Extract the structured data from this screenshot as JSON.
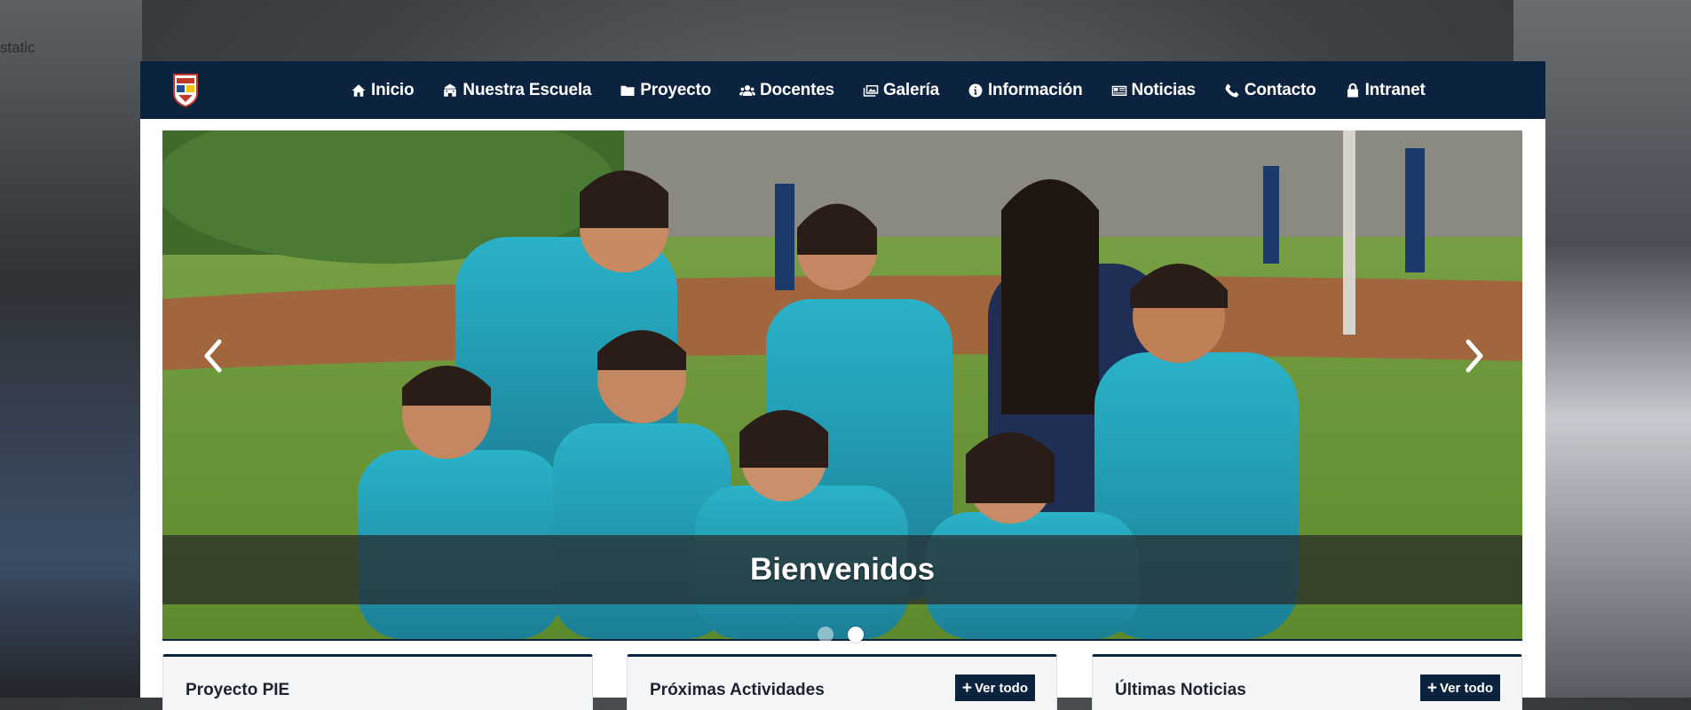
{
  "background_text": "static",
  "nav": {
    "items": [
      {
        "label": "Inicio",
        "icon": "home-icon"
      },
      {
        "label": "Nuestra Escuela",
        "icon": "school-icon"
      },
      {
        "label": "Proyecto",
        "icon": "folder-icon"
      },
      {
        "label": "Docentes",
        "icon": "users-icon"
      },
      {
        "label": "Galería",
        "icon": "images-icon"
      },
      {
        "label": "Información",
        "icon": "info-circle-icon"
      },
      {
        "label": "Noticias",
        "icon": "newspaper-icon"
      },
      {
        "label": "Contacto",
        "icon": "phone-icon"
      },
      {
        "label": "Intranet",
        "icon": "lock-icon"
      }
    ]
  },
  "carousel": {
    "caption": "Bienvenidos",
    "active_slide": 2,
    "slide_count": 2
  },
  "cards": [
    {
      "title": "Proyecto PIE"
    },
    {
      "title": "Próximas Actividades",
      "button": "Ver todo"
    },
    {
      "title": "Últimas Noticias",
      "button": "Ver todo"
    }
  ],
  "colors": {
    "navbar": "#0c2340",
    "accent": "#0c2340"
  }
}
